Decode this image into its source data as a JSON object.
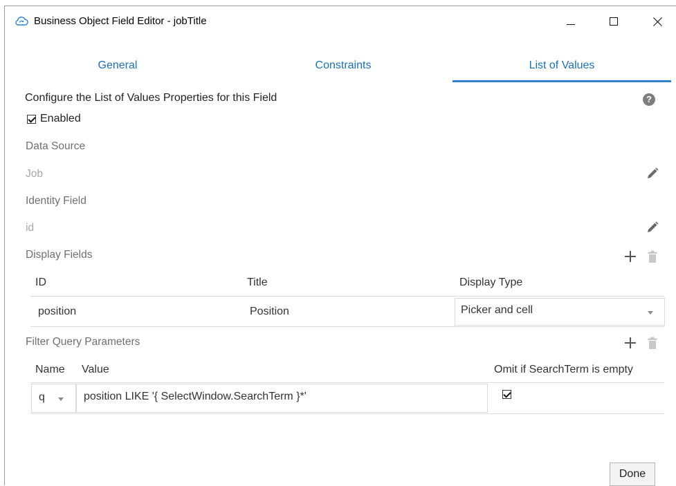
{
  "window": {
    "title": "Business Object Field Editor - jobTitle",
    "app_icon": "cloud-refresh-icon"
  },
  "tabs": [
    {
      "label": "General",
      "active": false
    },
    {
      "label": "Constraints",
      "active": false
    },
    {
      "label": "List of Values",
      "active": true
    }
  ],
  "section": {
    "heading": "Configure the List of Values Properties for this Field",
    "help_label": "?"
  },
  "enabled": {
    "label": "Enabled",
    "checked": true
  },
  "data_source": {
    "label": "Data Source",
    "value": "Job"
  },
  "identity_field": {
    "label": "Identity Field",
    "value": "id"
  },
  "display_fields": {
    "label": "Display Fields",
    "columns": [
      "ID",
      "Title",
      "Display Type"
    ],
    "rows": [
      {
        "id": "position",
        "title": "Position",
        "display_type": "Picker and cell"
      }
    ]
  },
  "filter_query": {
    "label": "Filter Query Parameters",
    "columns": [
      "Name",
      "Value",
      "Omit if SearchTerm is empty"
    ],
    "rows": [
      {
        "name": "q",
        "value": "position LIKE '{ SelectWindow.SearchTerm }*'",
        "omit": true
      }
    ]
  },
  "buttons": {
    "done": "Done"
  },
  "colors": {
    "accent": "#2b82c9",
    "tab_text": "#1e6fae",
    "muted_text": "#a7a7a7"
  }
}
